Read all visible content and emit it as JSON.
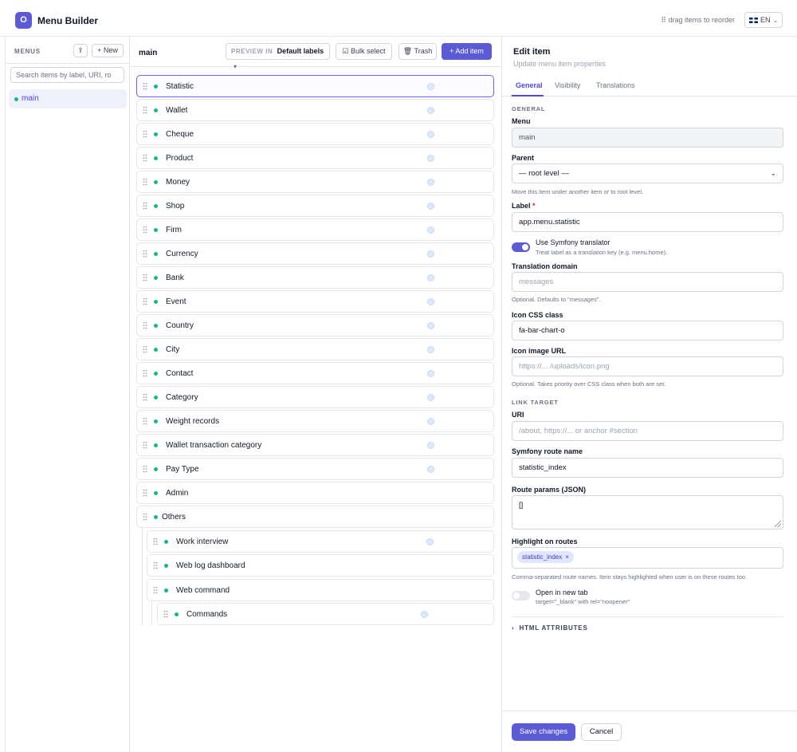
{
  "app": {
    "logo_letter": "O",
    "title": "Menu Builder",
    "drag_hint": "⠿ drag items to reorder",
    "language": "EN"
  },
  "sidebar": {
    "heading": "MENUS",
    "up_icon": "⇪",
    "new_label": "+ New",
    "search_placeholder": "Search items by label, URI, ro",
    "menus": [
      {
        "label": "main",
        "selected": true
      }
    ]
  },
  "middle": {
    "menu_name": "main",
    "preview_label": "PREVIEW IN",
    "preview_value": "Default labels",
    "bulk_label": "☑ Bulk select",
    "trash_label": "🗑 Trash",
    "add_label": "+ Add item",
    "items": [
      {
        "label": "Statistic",
        "depth": 0,
        "selected": true,
        "visibility_icon": true
      },
      {
        "label": "Wallet",
        "depth": 0,
        "visibility_icon": true
      },
      {
        "label": "Cheque",
        "depth": 0,
        "visibility_icon": true
      },
      {
        "label": "Product",
        "depth": 0,
        "visibility_icon": true
      },
      {
        "label": "Money",
        "depth": 0,
        "visibility_icon": true
      },
      {
        "label": "Shop",
        "depth": 0,
        "visibility_icon": true
      },
      {
        "label": "Firm",
        "depth": 0,
        "visibility_icon": true
      },
      {
        "label": "Currency",
        "depth": 0,
        "visibility_icon": true
      },
      {
        "label": "Bank",
        "depth": 0,
        "visibility_icon": true
      },
      {
        "label": "Event",
        "depth": 0,
        "visibility_icon": true
      },
      {
        "label": "Country",
        "depth": 0,
        "visibility_icon": true
      },
      {
        "label": "City",
        "depth": 0,
        "visibility_icon": true
      },
      {
        "label": "Contact",
        "depth": 0,
        "visibility_icon": true
      },
      {
        "label": "Category",
        "depth": 0,
        "visibility_icon": true
      },
      {
        "label": "Weight records",
        "depth": 0,
        "visibility_icon": true
      },
      {
        "label": "Wallet transaction category",
        "depth": 0,
        "visibility_icon": true
      },
      {
        "label": "Pay Type",
        "depth": 0,
        "visibility_icon": true
      },
      {
        "label": "Admin",
        "depth": 0,
        "visibility_icon": false
      },
      {
        "label": "Others",
        "depth": 0,
        "visibility_icon": false
      },
      {
        "label": "Work interview",
        "depth": 1,
        "visibility_icon": true
      },
      {
        "label": "Web log dashboard",
        "depth": 1,
        "visibility_icon": false
      },
      {
        "label": "Web command",
        "depth": 1,
        "visibility_icon": false
      },
      {
        "label": "Commands",
        "depth": 2,
        "visibility_icon": true
      }
    ]
  },
  "editor": {
    "title": "Edit item",
    "subtitle": "Update menu item properties",
    "tabs": [
      "General",
      "Visibility",
      "Translations"
    ],
    "active_tab": "General",
    "general_section": "GENERAL",
    "menu_label": "Menu",
    "menu_value": "main",
    "parent_label": "Parent",
    "parent_value": "— root level —",
    "parent_help": "Move this item under another item or to root level.",
    "label_label": "Label",
    "label_required": "*",
    "label_value": "app.menu.statistic",
    "translator_label": "Use Symfony translator",
    "translator_help": "Treat label as a translation key (e.g. menu.home).",
    "translator_on": true,
    "domain_label": "Translation domain",
    "domain_placeholder": "messages",
    "domain_help": "Optional. Defaults to \"messages\".",
    "icon_class_label": "Icon CSS class",
    "icon_class_value": "fa-bar-chart-o",
    "icon_url_label": "Icon image URL",
    "icon_url_placeholder": "https://... /uploads/icon.png",
    "icon_url_help": "Optional. Takes priority over CSS class when both are set.",
    "link_section": "LINK TARGET",
    "uri_label": "URI",
    "uri_placeholder": "/about, https://... or anchor #section",
    "route_label": "Symfony route name",
    "route_value": "statistic_index",
    "params_label": "Route params (JSON)",
    "params_value": "[]",
    "highlight_label": "Highlight on routes",
    "highlight_chip": "statistic_index",
    "highlight_chip_remove": "×",
    "highlight_help": "Comma-separated route names. Item stays highlighted when user is on these routes too.",
    "new_tab_label": "Open in new tab",
    "new_tab_help": "target=\"_blank\" with rel=\"noopener\"",
    "new_tab_on": false,
    "html_attributes": "HTML ATTRIBUTES",
    "save_label": "Save changes",
    "cancel_label": "Cancel"
  },
  "colors": {
    "accent": "#5b5bd6",
    "status_dot": "#10b981"
  }
}
